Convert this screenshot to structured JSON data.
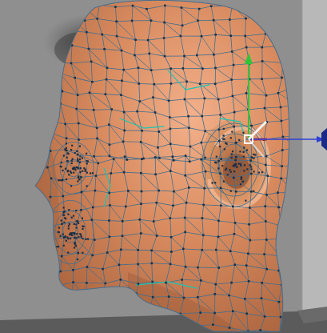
{
  "viewport": {
    "background_color": "#8f8f8f",
    "floor_color": "#595959",
    "shadow_color": "#3a3a3a",
    "right_strip_color": "#b9b9b9"
  },
  "head_model": {
    "skin_color": "#d98b5f",
    "skin_shadow_color": "#b06a42",
    "wire_color": "#3f6f8f",
    "highlight_edge_color": "#19c6b4",
    "vertex_color": "#1d2f44"
  },
  "transform_gizmo": {
    "x_axis_color": "#c0322d",
    "y_axis_color": "#2fc43a",
    "z_axis_color": "#2e3fd6",
    "center_color": "#ffffff",
    "edge_arrow_color": "#1b2a86"
  }
}
